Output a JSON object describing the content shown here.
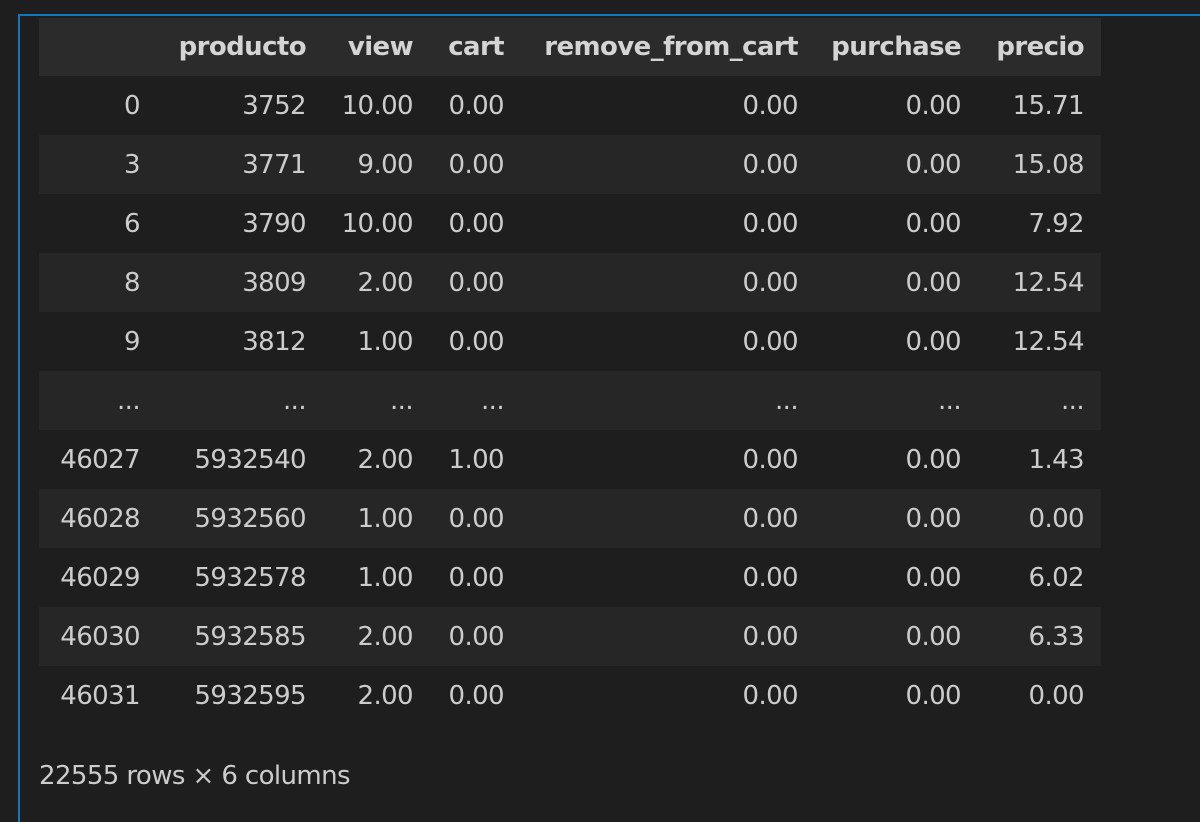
{
  "dataframe": {
    "columns": [
      "",
      "producto",
      "view",
      "cart",
      "remove_from_cart",
      "purchase",
      "precio"
    ],
    "rows": [
      {
        "index": "0",
        "producto": "3752",
        "view": "10.00",
        "cart": "0.00",
        "remove_from_cart": "0.00",
        "purchase": "0.00",
        "precio": "15.71"
      },
      {
        "index": "3",
        "producto": "3771",
        "view": "9.00",
        "cart": "0.00",
        "remove_from_cart": "0.00",
        "purchase": "0.00",
        "precio": "15.08"
      },
      {
        "index": "6",
        "producto": "3790",
        "view": "10.00",
        "cart": "0.00",
        "remove_from_cart": "0.00",
        "purchase": "0.00",
        "precio": "7.92"
      },
      {
        "index": "8",
        "producto": "3809",
        "view": "2.00",
        "cart": "0.00",
        "remove_from_cart": "0.00",
        "purchase": "0.00",
        "precio": "12.54"
      },
      {
        "index": "9",
        "producto": "3812",
        "view": "1.00",
        "cart": "0.00",
        "remove_from_cart": "0.00",
        "purchase": "0.00",
        "precio": "12.54"
      },
      {
        "index": "...",
        "producto": "...",
        "view": "...",
        "cart": "...",
        "remove_from_cart": "...",
        "purchase": "...",
        "precio": "..."
      },
      {
        "index": "46027",
        "producto": "5932540",
        "view": "2.00",
        "cart": "1.00",
        "remove_from_cart": "0.00",
        "purchase": "0.00",
        "precio": "1.43"
      },
      {
        "index": "46028",
        "producto": "5932560",
        "view": "1.00",
        "cart": "0.00",
        "remove_from_cart": "0.00",
        "purchase": "0.00",
        "precio": "0.00"
      },
      {
        "index": "46029",
        "producto": "5932578",
        "view": "1.00",
        "cart": "0.00",
        "remove_from_cart": "0.00",
        "purchase": "0.00",
        "precio": "6.02"
      },
      {
        "index": "46030",
        "producto": "5932585",
        "view": "2.00",
        "cart": "0.00",
        "remove_from_cart": "0.00",
        "purchase": "0.00",
        "precio": "6.33"
      },
      {
        "index": "46031",
        "producto": "5932595",
        "view": "2.00",
        "cart": "0.00",
        "remove_from_cart": "0.00",
        "purchase": "0.00",
        "precio": "0.00"
      }
    ],
    "shape_caption": "22555 rows × 6 columns"
  },
  "colors": {
    "background": "#1e1e1e",
    "header_background": "#2b2b2b",
    "stripe_background": "#262626",
    "focus_border": "#1177bb",
    "text": "#cccccc"
  }
}
